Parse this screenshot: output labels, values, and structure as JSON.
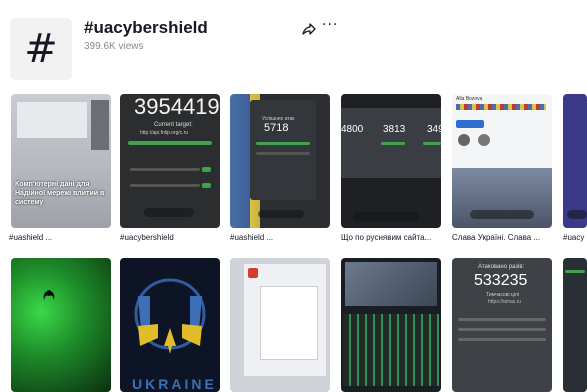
{
  "hashtag": {
    "symbol": "#",
    "title": "#uacybershield",
    "views": "399.6K views"
  },
  "actions": {
    "share_icon": "share-icon",
    "more": "···"
  },
  "row1": [
    {
      "caption": "#uashield ...",
      "overlay": "Комп'ютерні дані для Надійної мережі влитий в систему"
    },
    {
      "caption": "#uacybershield",
      "big": "3954419",
      "sub": "Current target:",
      "url": "http://api.fnlip.org/c.ru"
    },
    {
      "caption": "#uashield ...",
      "big": "5718",
      "sub": "Успішних атак"
    },
    {
      "caption": "Що по руснявим сайта...",
      "n1": "4800",
      "n2": "3813",
      "n3": "349"
    },
    {
      "caption": "Слава Україні. Слава ...",
      "name": "Alla Bozova"
    },
    {
      "caption": "#uacy"
    }
  ],
  "row2": [
    {
      "caption": ""
    },
    {
      "caption": "",
      "bottom": "UKRAINE"
    },
    {
      "caption": ""
    },
    {
      "caption": ""
    },
    {
      "caption": "",
      "label": "Атаковано разів:",
      "big": "533235",
      "sub": "Тимчасові цілі",
      "url": "https://amas.ru"
    },
    {
      "caption": ""
    }
  ]
}
